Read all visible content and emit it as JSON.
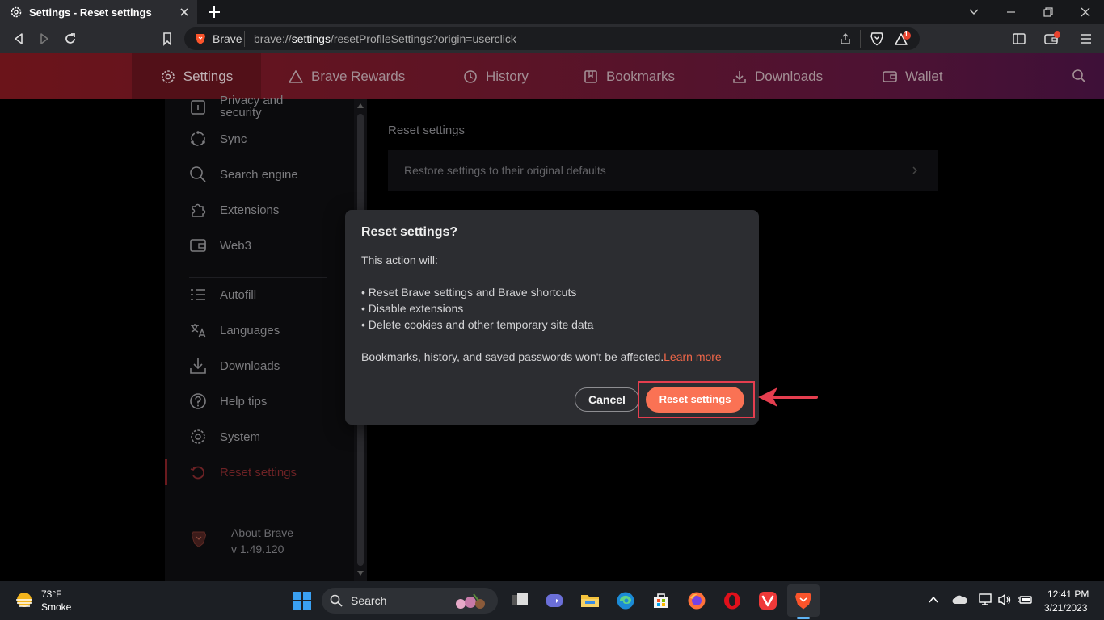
{
  "tab": {
    "title": "Settings - Reset settings"
  },
  "address": {
    "site": "Brave",
    "url_prefix": "brave://",
    "url_bold": "settings",
    "url_suffix": "/resetProfileSettings?origin=userclick"
  },
  "rewards_badge": "1",
  "nav": {
    "items": [
      {
        "label": "Settings",
        "icon": "gear-icon"
      },
      {
        "label": "Brave Rewards",
        "icon": "triangle-icon"
      },
      {
        "label": "History",
        "icon": "history-icon"
      },
      {
        "label": "Bookmarks",
        "icon": "bookmark-icon"
      },
      {
        "label": "Downloads",
        "icon": "download-icon"
      },
      {
        "label": "Wallet",
        "icon": "wallet-icon"
      }
    ]
  },
  "sidebar": {
    "items": [
      {
        "label_line1": "Privacy and",
        "label_line2": "security"
      },
      {
        "label": "Sync"
      },
      {
        "label": "Search engine"
      },
      {
        "label": "Extensions"
      },
      {
        "label": "Web3"
      },
      {
        "label": "Autofill"
      },
      {
        "label": "Languages"
      },
      {
        "label": "Downloads"
      },
      {
        "label": "Help tips"
      },
      {
        "label": "System"
      },
      {
        "label": "Reset settings"
      }
    ],
    "about": {
      "label": "About Brave",
      "version": "v 1.49.120"
    }
  },
  "main": {
    "title": "Reset settings",
    "row_label": "Restore settings to their original defaults"
  },
  "dialog": {
    "title": "Reset settings?",
    "intro": "This action will:",
    "bullets": [
      "• Reset Brave settings and Brave shortcuts",
      "• Disable extensions",
      "• Delete cookies and other temporary site data"
    ],
    "note": "Bookmarks, history, and saved passwords won't be affected.",
    "learn_more": "Learn more",
    "cancel": "Cancel",
    "confirm": "Reset settings"
  },
  "taskbar": {
    "temperature": "73°F",
    "weather": "Smoke",
    "search": "Search",
    "time": "12:41 PM",
    "date": "3/21/2023"
  },
  "colors": {
    "accent": "#fa7254",
    "link": "#f26749",
    "highlight": "#e53e4f",
    "header_start": "#6b141a",
    "header_end": "#3e1038"
  }
}
